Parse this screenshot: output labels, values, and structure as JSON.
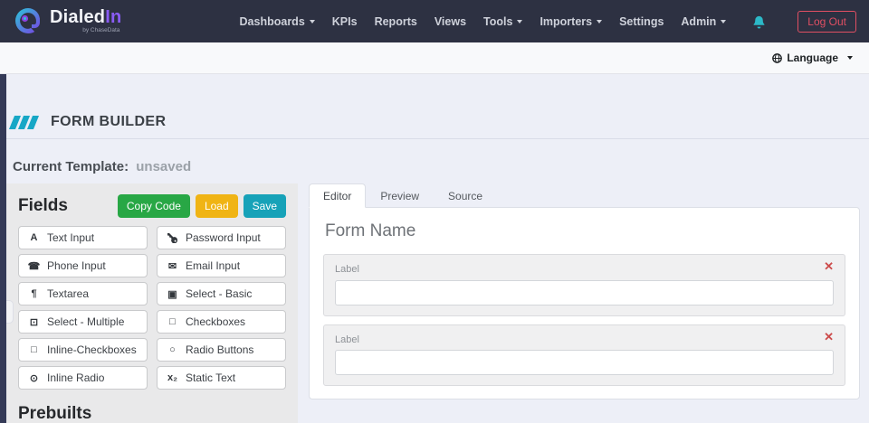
{
  "navbar": {
    "brand": {
      "name_primary": "Dialed",
      "name_accent": "In",
      "tagline": "by ChaseData"
    },
    "items": [
      {
        "label": "Dashboards",
        "dropdown": true
      },
      {
        "label": "KPIs",
        "dropdown": false
      },
      {
        "label": "Reports",
        "dropdown": false
      },
      {
        "label": "Views",
        "dropdown": false
      },
      {
        "label": "Tools",
        "dropdown": true
      },
      {
        "label": "Importers",
        "dropdown": true
      },
      {
        "label": "Settings",
        "dropdown": false
      },
      {
        "label": "Admin",
        "dropdown": true
      }
    ],
    "logout_label": "Log Out"
  },
  "language_bar": {
    "label": "Language"
  },
  "page": {
    "title": "FORM BUILDER",
    "current_template_label": "Current Template:",
    "current_template_value": "unsaved"
  },
  "fields_panel": {
    "title": "Fields",
    "prebuilts_title": "Prebuilts",
    "actions": {
      "copy_code": "Copy Code",
      "load": "Load",
      "save": "Save"
    },
    "fields": [
      {
        "label": "Text Input",
        "glyph": "A",
        "icon": "font-icon"
      },
      {
        "label": "Password Input",
        "glyph": "",
        "icon": "key-icon"
      },
      {
        "label": "Phone Input",
        "glyph": "☎",
        "icon": "phone-icon"
      },
      {
        "label": "Email Input",
        "glyph": "✉",
        "icon": "envelope-icon"
      },
      {
        "label": "Textarea",
        "glyph": "¶",
        "icon": "paragraph-icon"
      },
      {
        "label": "Select - Basic",
        "glyph": "▣",
        "icon": "caret-square-icon"
      },
      {
        "label": "Select - Multiple",
        "glyph": "⊡",
        "icon": "square-dot-icon"
      },
      {
        "label": "Checkboxes",
        "glyph": "□",
        "icon": "checkbox-icon"
      },
      {
        "label": "Inline-Checkboxes",
        "glyph": "□",
        "icon": "checkbox-icon"
      },
      {
        "label": "Radio Buttons",
        "glyph": "○",
        "icon": "radio-icon"
      },
      {
        "label": "Inline Radio",
        "glyph": "⊙",
        "icon": "radio-dot-icon"
      },
      {
        "label": "Static Text",
        "glyph": "x₂",
        "icon": "subscript-icon"
      }
    ]
  },
  "editor_panel": {
    "tabs": [
      {
        "label": "Editor",
        "active": true
      },
      {
        "label": "Preview",
        "active": false
      },
      {
        "label": "Source",
        "active": false
      }
    ],
    "form_name": "Form Name",
    "form_fields": [
      {
        "label_placeholder": "Label",
        "value": "",
        "remove_glyph": "✕"
      },
      {
        "label_placeholder": "Label",
        "value": "",
        "remove_glyph": "✕"
      }
    ]
  },
  "colors": {
    "navbar_bg": "#2d3142",
    "brand_accent": "#8a5cf5",
    "teal_accent": "#17a7c6",
    "bell": "#2cb9c8",
    "logout_red": "#e04f63",
    "copy_code_green": "#28a745",
    "load_yellow": "#f0b414",
    "save_teal": "#17a2b8",
    "remove_red": "#cc4b4b"
  }
}
